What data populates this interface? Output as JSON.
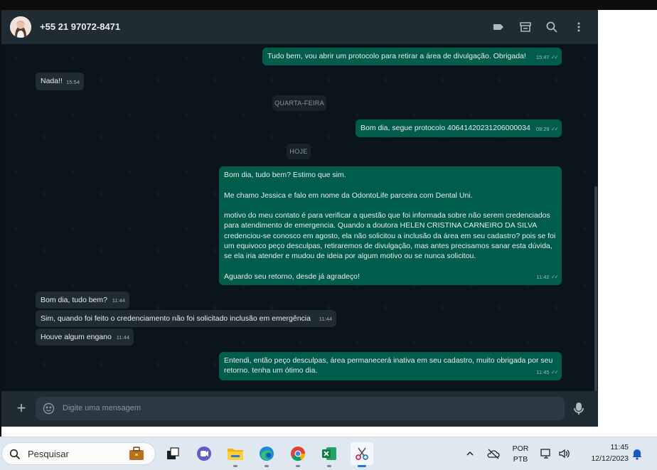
{
  "header": {
    "contact_name": "+55 21 97072-8471",
    "icons": [
      "label-icon",
      "catalog-icon",
      "search-icon",
      "menu-icon"
    ]
  },
  "messages": [
    {
      "dir": "out",
      "text": "Tudo bem, vou abrir um protocolo para retirar a área de divulgação. Obrigada!",
      "time": "15:47"
    },
    {
      "dir": "in",
      "text": "Nada!!",
      "time": "15:54"
    },
    {
      "dir": "date",
      "text": "QUARTA-FEIRA"
    },
    {
      "dir": "out",
      "text": "Bom dia, segue protocolo 40641420231206000034",
      "time": "09:29"
    },
    {
      "dir": "date",
      "text": "HOJE"
    },
    {
      "dir": "out",
      "text": "Bom dia, tudo bem? Estimo que sim.\n\nMe chamo Jessica e falo em nome da OdontoLife parceira com Dental Uni.\n\nmotivo do meu contato é para verificar a questão que foi informada sobre não serem credenciados\npara atendimento de emergencia. Quando a doutora HELEN CRISTINA CARNEIRO DA SILVA\ncredenciou-se conosco em agosto, ela não solicitou a inclusão da área em seu cadastro? pois se foi\num equivoco peço desculpas, retiraremos de divulgação, mas antes precisamos sanar esta dúvida,\nse ela iria atender e mudou de ideia por algum motivo ou se nunca solicitou.\n\nAguardo seu retorno, desde já agradeço!",
      "time": "11:42"
    },
    {
      "dir": "in",
      "text": "Bom dia, tudo bem?",
      "time": "11:44"
    },
    {
      "dir": "in",
      "text": "Sim, quando foi feito o credenciamento não foi solicitado inclusão em emergência",
      "time": "11:44"
    },
    {
      "dir": "in",
      "text": "Houve algum engano",
      "time": "11:44"
    },
    {
      "dir": "out",
      "text": "Entendi, então peço desculpas, área permanecerá inativa em seu cadastro, muito obrigada por seu\nretorno. tenha um ótimo dia.",
      "time": "11:45"
    }
  ],
  "composer": {
    "placeholder": "Digite uma mensagem"
  },
  "taskbar": {
    "search_label": "Pesquisar",
    "apps": [
      "briefcase-icon",
      "task-view-icon",
      "teams-icon",
      "file-explorer-icon",
      "edge-icon",
      "chrome-icon",
      "excel-icon",
      "snipping-tool-icon"
    ],
    "language_line1": "POR",
    "language_line2": "PTB",
    "clock_time": "11:45",
    "clock_date": "12/12/2023"
  }
}
